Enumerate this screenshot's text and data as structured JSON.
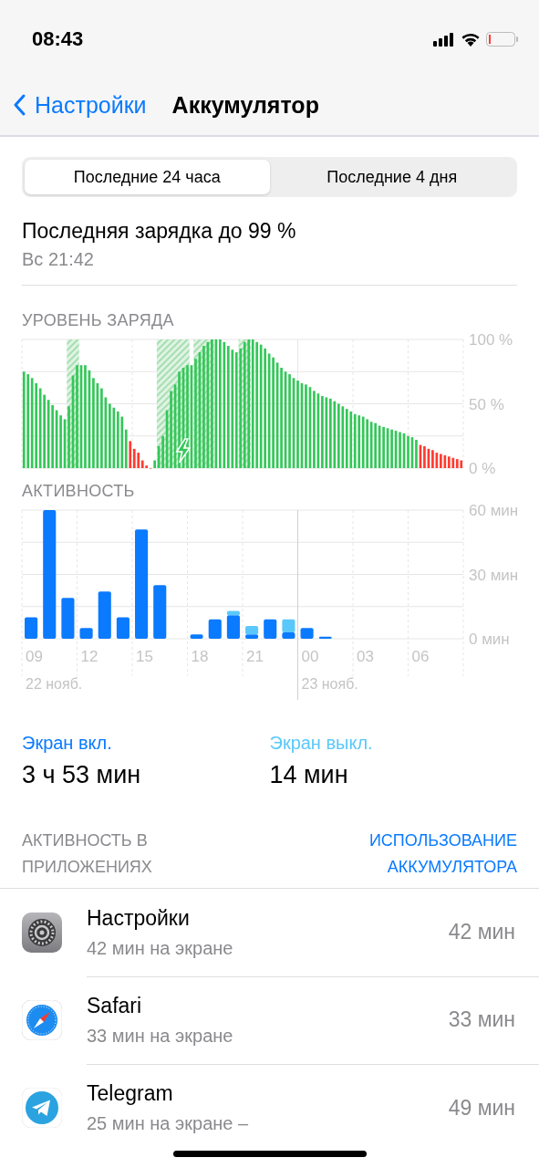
{
  "status_bar": {
    "time": "08:43"
  },
  "nav": {
    "back": "Настройки",
    "title": "Аккумулятор"
  },
  "segments": [
    {
      "label": "Последние 24 часа",
      "selected": true
    },
    {
      "label": "Последние 4 дня",
      "selected": false
    }
  ],
  "last_charge": {
    "title": "Последняя зарядка до 99 %",
    "time": "Вс 21:42"
  },
  "battery_chart": {
    "title": "УРОВЕНЬ ЗАРЯДА",
    "chart_data": {
      "type": "bar",
      "grid": true,
      "ylim": [
        0,
        100
      ],
      "yticks": [
        {
          "value": 0,
          "label": "0 %"
        },
        {
          "value": 50,
          "label": "50 %"
        },
        {
          "value": 100,
          "label": "100 %"
        }
      ],
      "series": [
        {
          "color": "#34c759",
          "values": [
            75,
            73,
            70,
            66,
            62,
            57,
            53,
            49,
            45,
            41,
            38,
            48,
            72,
            80,
            80,
            80,
            76,
            70,
            66,
            62,
            55,
            50,
            47,
            44,
            40,
            30,
            null,
            null,
            null,
            null,
            null,
            null,
            6,
            17,
            25,
            45,
            60,
            65,
            75,
            78,
            80,
            80,
            85,
            90,
            95,
            98,
            100,
            100,
            100,
            98,
            95,
            92,
            90,
            93,
            98,
            100,
            100,
            98,
            96,
            93,
            89,
            86,
            82,
            78,
            75,
            73,
            70,
            68,
            66,
            65,
            63,
            60,
            58,
            56,
            55,
            54,
            52,
            50,
            48,
            46,
            44,
            42,
            41,
            40,
            38,
            36,
            35,
            33,
            32,
            31,
            30,
            29,
            28,
            27,
            25,
            24,
            22,
            null,
            null,
            null,
            null,
            null,
            null,
            null,
            null,
            null,
            null,
            null
          ]
        },
        {
          "color": "#ff3b30",
          "values": [
            null,
            null,
            null,
            null,
            null,
            null,
            null,
            null,
            null,
            null,
            null,
            null,
            null,
            null,
            null,
            null,
            null,
            null,
            null,
            null,
            null,
            null,
            null,
            null,
            null,
            null,
            21,
            15,
            12,
            6,
            2,
            0,
            null,
            null,
            null,
            null,
            null,
            null,
            null,
            null,
            null,
            null,
            null,
            null,
            null,
            null,
            null,
            null,
            null,
            null,
            null,
            null,
            null,
            null,
            null,
            null,
            null,
            null,
            null,
            null,
            null,
            null,
            null,
            null,
            null,
            null,
            null,
            null,
            null,
            null,
            null,
            null,
            null,
            null,
            null,
            null,
            null,
            null,
            null,
            null,
            null,
            null,
            null,
            null,
            null,
            null,
            null,
            null,
            null,
            null,
            null,
            null,
            null,
            null,
            null,
            null,
            null,
            18,
            17,
            15,
            14,
            12,
            11,
            10,
            9,
            8,
            7,
            6
          ]
        }
      ]
    }
  },
  "activity_chart": {
    "title": "АКТИВНОСТЬ",
    "dates": [
      "22 нояб.",
      "23 нояб."
    ],
    "chart_data": {
      "type": "bar",
      "stacked": true,
      "grid": true,
      "ylim": [
        0,
        60
      ],
      "yticks": [
        {
          "value": 0,
          "label": "0 мин"
        },
        {
          "value": 30,
          "label": "30 мин"
        },
        {
          "value": 60,
          "label": "60 мин"
        }
      ],
      "categories": [
        "09",
        null,
        null,
        "12",
        null,
        null,
        "15",
        null,
        null,
        "18",
        null,
        null,
        "21",
        null,
        null,
        "00",
        null,
        null,
        "03",
        null,
        null,
        "06",
        null,
        null
      ],
      "series": [
        {
          "color": "#0a7aff",
          "values": [
            10,
            60,
            19,
            5,
            22,
            10,
            51,
            25,
            0,
            2,
            9,
            11,
            2,
            9,
            3,
            5,
            1,
            0,
            0,
            0,
            0,
            0,
            0,
            0
          ]
        },
        {
          "color": "#5ac8fa",
          "values": [
            0,
            0,
            0,
            0,
            0,
            0,
            0,
            0,
            0,
            0,
            0,
            2,
            4,
            0,
            6,
            0,
            0,
            0,
            0,
            0,
            0,
            0,
            0,
            0
          ]
        }
      ]
    }
  },
  "totals": [
    {
      "label": "Экран вкл.",
      "value": "3 ч 53 мин",
      "color": "#0a7aff"
    },
    {
      "label": "Экран выкл.",
      "value": "14 мин",
      "color": "#5ac8fa"
    }
  ],
  "apps_header": {
    "title": "АКТИВНОСТЬ В ПРИЛОЖЕНИЯХ",
    "link": "ИСПОЛЬЗОВАНИЕ АККУМУЛЯТОРА"
  },
  "apps": [
    {
      "kind": "settings",
      "name": "Настройки",
      "detail": "42 мин на экране",
      "usage": "42 мин"
    },
    {
      "kind": "safari",
      "name": "Safari",
      "detail": "33 мин на экране",
      "usage": "33 мин"
    },
    {
      "kind": "telegram",
      "name": "Telegram",
      "detail": "25 мин на экране –",
      "usage": "49 мин"
    }
  ]
}
